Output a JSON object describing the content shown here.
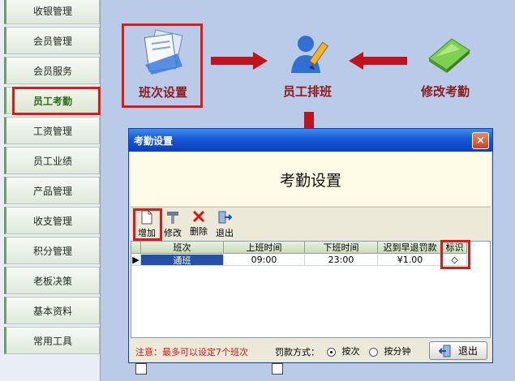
{
  "sidebar": {
    "items": [
      {
        "label": "收银管理"
      },
      {
        "label": "会员管理"
      },
      {
        "label": "会员服务"
      },
      {
        "label": "员工考勤"
      },
      {
        "label": "工资管理"
      },
      {
        "label": "员工业绩"
      },
      {
        "label": "产品管理"
      },
      {
        "label": "收支管理"
      },
      {
        "label": "积分管理"
      },
      {
        "label": "老板决策"
      },
      {
        "label": "基本资料"
      },
      {
        "label": "常用工具"
      }
    ],
    "active_index": 3
  },
  "flow": {
    "shift_setup_label": "班次设置",
    "staff_schedule_label": "员工排班",
    "edit_attendance_label": "修改考勤"
  },
  "dialog": {
    "title": "考勤设置",
    "heading": "考勤设置",
    "toolbar": {
      "add_label": "增加",
      "edit_label": "修改",
      "delete_label": "删除",
      "exit_label": "退出"
    },
    "grid": {
      "columns": [
        "班次",
        "上班时间",
        "下班时间",
        "迟到早退罚款",
        "标识"
      ],
      "rows": [
        {
          "shift": "通班",
          "start": "09:00",
          "end": "23:00",
          "fine": "¥1.00",
          "mark": "◇"
        }
      ]
    },
    "footer": {
      "note": "注意：最多可以设定7个班次",
      "penalty_label": "罚款方式：",
      "option_per_shift": "按次",
      "option_per_minute": "按分钟",
      "selected": "按次",
      "exit_label": "退出"
    }
  },
  "colors": {
    "highlight_red": "#e01818",
    "arrow_red": "#c3121b",
    "label_red": "#8b1a1a",
    "background": "#b9cbe8"
  }
}
